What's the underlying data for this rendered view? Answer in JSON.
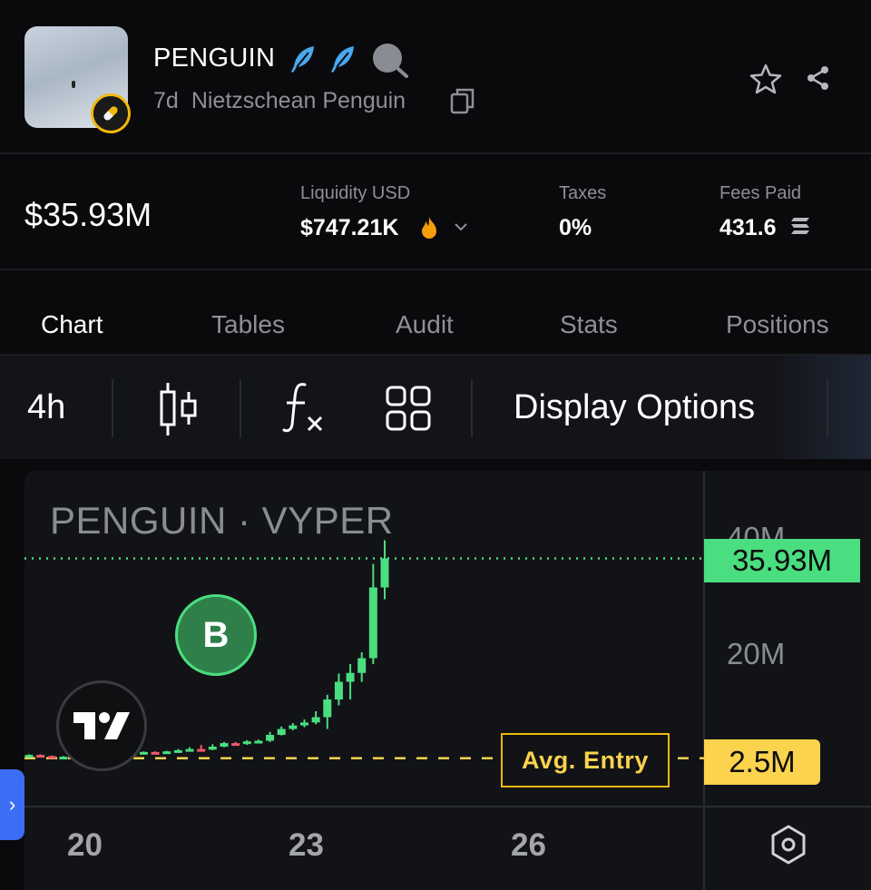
{
  "header": {
    "token_symbol": "PENGUIN",
    "age": "7d",
    "token_fullname": "Nietzschean Penguin"
  },
  "stats": {
    "market_cap": "$35.93M",
    "liquidity_label": "Liquidity USD",
    "liquidity_value": "$747.21K",
    "taxes_label": "Taxes",
    "taxes_value": "0%",
    "fees_label": "Fees Paid",
    "fees_value": "431.6"
  },
  "tabs": [
    "Chart",
    "Tables",
    "Audit",
    "Stats",
    "Positions"
  ],
  "toolbar": {
    "interval": "4h",
    "display_options": "Display Options"
  },
  "chart": {
    "title": "PENGUIN · VYPER",
    "current_price_tag": "35.93M",
    "avg_entry_label": "Avg. Entry",
    "avg_entry_tag": "2.5M",
    "trade_marker": "B",
    "y_ticks": [
      "40M",
      "20M"
    ],
    "x_ticks": [
      "20",
      "23",
      "26"
    ]
  },
  "colors": {
    "up": "#4ade80",
    "down": "#f05a6a",
    "avg_entry": "#fcd34d",
    "accent_blue": "#3b6ef5"
  },
  "chart_data": {
    "type": "candlestick",
    "unit": "market cap (USD)",
    "x_ticks": [
      "20",
      "23",
      "26"
    ],
    "y_ticks": [
      20000000,
      40000000
    ],
    "ylim": [
      0,
      44000000
    ],
    "current_value": 35930000,
    "avg_entry": 2500000,
    "candles": [
      {
        "o": 2500000.0,
        "c": 2600000.0,
        "h": 2700000.0,
        "l": 2300000.0,
        "dir": "up"
      },
      {
        "o": 2600000.0,
        "c": 2400000.0,
        "h": 2700000.0,
        "l": 2200000.0,
        "dir": "down"
      },
      {
        "o": 2400000.0,
        "c": 2100000.0,
        "h": 2500000.0,
        "l": 2000000.0,
        "dir": "down"
      },
      {
        "o": 2100000.0,
        "c": 2300000.0,
        "h": 2400000.0,
        "l": 2000000.0,
        "dir": "up"
      },
      {
        "o": 2300000.0,
        "c": 2500000.0,
        "h": 2600000.0,
        "l": 2200000.0,
        "dir": "up"
      },
      {
        "o": 2500000.0,
        "c": 2400000.0,
        "h": 2600000.0,
        "l": 2300000.0,
        "dir": "down"
      },
      {
        "o": 2400000.0,
        "c": 2600000.0,
        "h": 2700000.0,
        "l": 2300000.0,
        "dir": "up"
      },
      {
        "o": 2600000.0,
        "c": 2800000.0,
        "h": 2900000.0,
        "l": 2500000.0,
        "dir": "up"
      },
      {
        "o": 2800000.0,
        "c": 2700000.0,
        "h": 2900000.0,
        "l": 2600000.0,
        "dir": "down"
      },
      {
        "o": 2700000.0,
        "c": 2900000.0,
        "h": 3000000.0,
        "l": 2600000.0,
        "dir": "up"
      },
      {
        "o": 2900000.0,
        "c": 3100000.0,
        "h": 3200000.0,
        "l": 2800000.0,
        "dir": "up"
      },
      {
        "o": 3100000.0,
        "c": 3000000.0,
        "h": 3200000.0,
        "l": 2900000.0,
        "dir": "down"
      },
      {
        "o": 3000000.0,
        "c": 3200000.0,
        "h": 3300000.0,
        "l": 2900000.0,
        "dir": "up"
      },
      {
        "o": 3200000.0,
        "c": 3400000.0,
        "h": 3600000.0,
        "l": 3100000.0,
        "dir": "up"
      },
      {
        "o": 3400000.0,
        "c": 3600000.0,
        "h": 3900000.0,
        "l": 3300000.0,
        "dir": "up"
      },
      {
        "o": 3600000.0,
        "c": 3500000.0,
        "h": 4300000.0,
        "l": 3400000.0,
        "dir": "down"
      },
      {
        "o": 3500000.0,
        "c": 4000000.0,
        "h": 4400000.0,
        "l": 3400000.0,
        "dir": "up"
      },
      {
        "o": 4000000.0,
        "c": 4600000.0,
        "h": 4800000.0,
        "l": 3900000.0,
        "dir": "up"
      },
      {
        "o": 4600000.0,
        "c": 4500000.0,
        "h": 4800000.0,
        "l": 4300000.0,
        "dir": "down"
      },
      {
        "o": 4500000.0,
        "c": 4900000.0,
        "h": 5100000.0,
        "l": 4300000.0,
        "dir": "up"
      },
      {
        "o": 4900000.0,
        "c": 5000000.0,
        "h": 5200000.0,
        "l": 4800000.0,
        "dir": "up"
      },
      {
        "o": 5000000.0,
        "c": 6000000.0,
        "h": 6500000.0,
        "l": 4800000.0,
        "dir": "up"
      },
      {
        "o": 6000000.0,
        "c": 7000000.0,
        "h": 7400000.0,
        "l": 5900000.0,
        "dir": "up"
      },
      {
        "o": 7000000.0,
        "c": 7600000.0,
        "h": 8000000.0,
        "l": 6800000.0,
        "dir": "up"
      },
      {
        "o": 7600000.0,
        "c": 8100000.0,
        "h": 8600000.0,
        "l": 7300000.0,
        "dir": "up"
      },
      {
        "o": 8100000.0,
        "c": 9000000.0,
        "h": 10000000.0,
        "l": 7800000.0,
        "dir": "up"
      },
      {
        "o": 9000000.0,
        "c": 12000000.0,
        "h": 12800000.0,
        "l": 7000000.0,
        "dir": "up"
      },
      {
        "o": 12000000.0,
        "c": 15000000.0,
        "h": 16400000.0,
        "l": 11000000.0,
        "dir": "up"
      },
      {
        "o": 15000000.0,
        "c": 16500000.0,
        "h": 18000000.0,
        "l": 12000000.0,
        "dir": "up"
      },
      {
        "o": 16500000.0,
        "c": 19000000.0,
        "h": 20000000.0,
        "l": 15000000.0,
        "dir": "up"
      },
      {
        "o": 19000000.0,
        "c": 31000000.0,
        "h": 35000000.0,
        "l": 18000000.0,
        "dir": "up"
      },
      {
        "o": 31000000.0,
        "c": 35930000.0,
        "h": 39000000.0,
        "l": 29000000.0,
        "dir": "up"
      }
    ]
  }
}
